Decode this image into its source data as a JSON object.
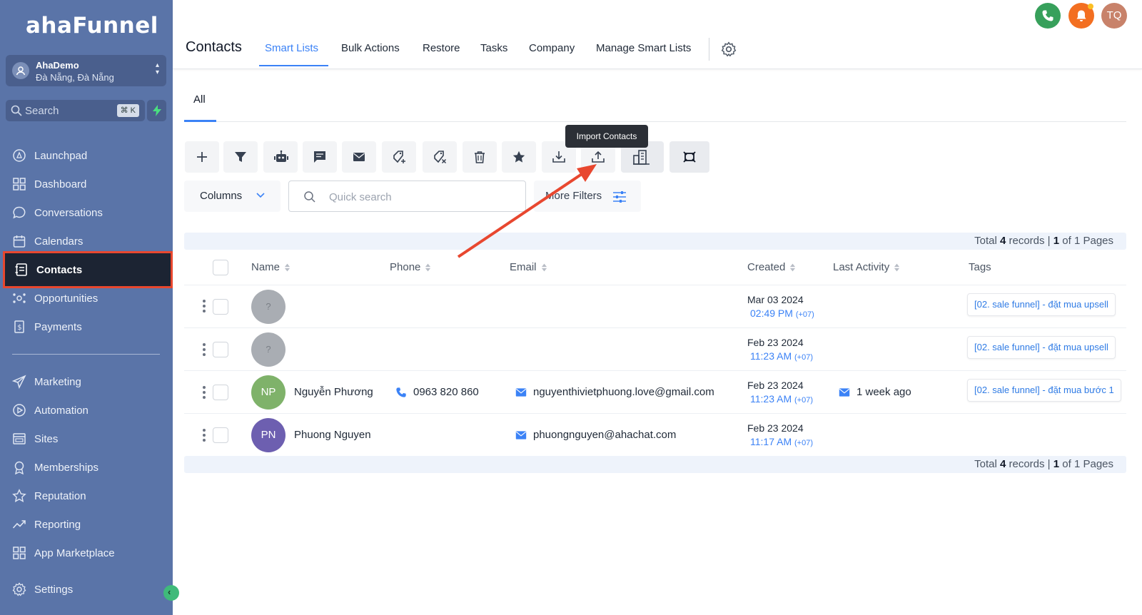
{
  "sidebar": {
    "logo": "ahaFunnel",
    "account": {
      "name": "AhaDemo",
      "location": "Đà Nẵng, Đà Nẵng"
    },
    "search": {
      "placeholder": "Search",
      "shortcut": "⌘ K"
    },
    "items": [
      {
        "label": "Launchpad",
        "icon": "launchpad-icon"
      },
      {
        "label": "Dashboard",
        "icon": "dashboard-icon"
      },
      {
        "label": "Conversations",
        "icon": "chat-bubble-icon"
      },
      {
        "label": "Calendars",
        "icon": "calendar-icon"
      },
      {
        "label": "Contacts",
        "icon": "contacts-icon",
        "active": true
      },
      {
        "label": "Opportunities",
        "icon": "opportunities-icon"
      },
      {
        "label": "Payments",
        "icon": "payments-icon"
      },
      {
        "label": "Marketing",
        "icon": "send-icon"
      },
      {
        "label": "Automation",
        "icon": "automation-icon"
      },
      {
        "label": "Sites",
        "icon": "sites-icon"
      },
      {
        "label": "Memberships",
        "icon": "membership-icon"
      },
      {
        "label": "Reputation",
        "icon": "star-icon"
      },
      {
        "label": "Reporting",
        "icon": "trend-icon"
      },
      {
        "label": "App Marketplace",
        "icon": "grid-icon"
      },
      {
        "label": "Settings",
        "icon": "gear-icon"
      }
    ]
  },
  "header": {
    "title": "Contacts",
    "tabs": [
      "Smart Lists",
      "Bulk Actions",
      "Restore",
      "Tasks",
      "Company",
      "Manage Smart Lists"
    ],
    "active_tab": "Smart Lists",
    "user_initials": "TQ"
  },
  "subtabs": {
    "all": "All"
  },
  "toolbar": {
    "tooltip": "Import Contacts",
    "icons": [
      "add-icon",
      "filter-icon",
      "robot-icon",
      "sms-icon",
      "email-icon",
      "add-tag-icon",
      "remove-tag-icon",
      "delete-icon",
      "star-icon",
      "export-icon",
      "import-icon",
      "company-icon",
      "merge-icon"
    ]
  },
  "filters": {
    "columns_label": "Columns",
    "search_placeholder": "Quick search",
    "more_filters_label": "More Filters"
  },
  "summary": {
    "prefix": "Total",
    "records": "4",
    "records_word": "records |",
    "page": "1",
    "of_pages": "of 1 Pages"
  },
  "table": {
    "headers": [
      "Name",
      "Phone",
      "Email",
      "Created",
      "Last Activity",
      "Tags"
    ],
    "rows": [
      {
        "avatar": "?",
        "name": "",
        "phone": "",
        "email": "",
        "created_date": "Mar 03 2024",
        "created_time": "02:49 PM",
        "tz": "(+07)",
        "last_activity": "",
        "tag": "[02. sale funnel] - đặt mua upsell"
      },
      {
        "avatar": "?",
        "name": "",
        "phone": "",
        "email": "",
        "created_date": "Feb 23 2024",
        "created_time": "11:23 AM",
        "tz": "(+07)",
        "last_activity": "",
        "tag": "[02. sale funnel] - đặt mua upsell"
      },
      {
        "avatar": "NP",
        "name": "Nguyễn Phương",
        "phone": "0963 820 860",
        "email": "nguyenthivietphuong.love@gmail.com",
        "created_date": "Feb 23 2024",
        "created_time": "11:23 AM",
        "tz": "(+07)",
        "last_activity": "1 week ago",
        "tag": "[02. sale funnel] - đặt mua bước 1"
      },
      {
        "avatar": "PN",
        "name": "Phuong Nguyen",
        "phone": "",
        "email": "phuongnguyen@ahachat.com",
        "created_date": "Feb 23 2024",
        "created_time": "11:17 AM",
        "tz": "(+07)",
        "last_activity": "",
        "tag": ""
      }
    ]
  },
  "colors": {
    "sidebar": "#5a74a8",
    "accent": "#3b82f6",
    "highlight": "#e8472f"
  }
}
